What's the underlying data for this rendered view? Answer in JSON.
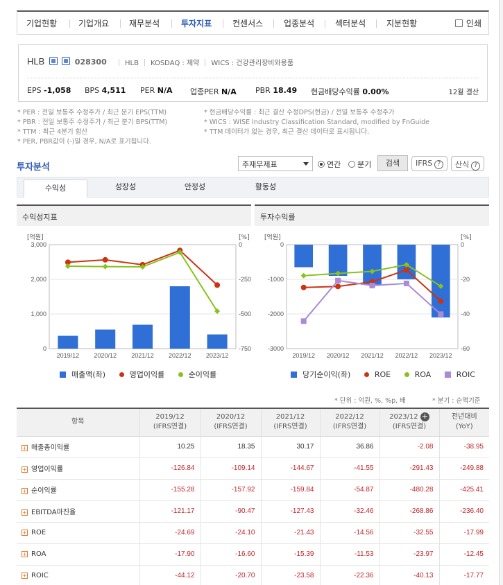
{
  "nav": {
    "tabs": [
      "기업현황",
      "기업개요",
      "재무분석",
      "투자지표",
      "컨센서스",
      "업종분석",
      "섹터분석",
      "지분현황"
    ],
    "active_index": 3,
    "print_label": "인쇄"
  },
  "corp": {
    "name": "HLB",
    "code": "028300",
    "ticker": "HLB",
    "market": "KOSDAQ : 제약",
    "wics": "WICS : 건강관리장비와용품",
    "indicators": [
      {
        "label": "EPS",
        "value": "-1,058"
      },
      {
        "label": "BPS",
        "value": "4,511"
      },
      {
        "label": "PER",
        "value": "N/A"
      },
      {
        "label": "업종PER",
        "value": "N/A"
      },
      {
        "label": "PBR",
        "value": "18.49"
      },
      {
        "label": "현금배당수익률",
        "value": "0.00%"
      }
    ],
    "settle": "12월 결산"
  },
  "notes": {
    "left": [
      "* PER : 전일 보통주 수정주가 / 최근 분기 EPS(TTM)",
      "* PBR : 전일 보통주 수정주가 / 최근 분기 BPS(TTM)",
      "* TTM : 최근 4분기 합산",
      "* PER, PBR값이 (-)일 경우, N/A로 표기됩니다."
    ],
    "right": [
      "* 현금배당수익률 : 최근 결산 수정DPS(현금) / 전일 보통주 수정주가",
      "* WICS : WISE Industry Classification Standard, modified by FnGuide",
      "* TTM 데이터가 없는 경우, 최근 결산 데이터로 표시됩니다."
    ]
  },
  "analysis": {
    "title": "투자분석",
    "select_value": "주재무제표",
    "radio_annual": "연간",
    "radio_quarter": "분기",
    "search_label": "검색",
    "ifrs_label": "IFRS",
    "formula_label": "산식",
    "subtabs": [
      "수익성",
      "성장성",
      "안정성",
      "활동성"
    ]
  },
  "charts": {
    "left_title": "수익성지표",
    "right_title": "투자수익률",
    "unit_left": "[억원]",
    "unit_right": "[%]"
  },
  "chart_data": [
    {
      "type": "bar",
      "title": "수익성지표",
      "categories": [
        "2019/12",
        "2020/12",
        "2021/12",
        "2022/12",
        "2023/12"
      ],
      "ylabel": "[억원]",
      "y2label": "[%]",
      "ylim": [
        0,
        3000
      ],
      "y2lim": [
        -750,
        0
      ],
      "yticks": [
        "3,000",
        "2,000",
        "1,000",
        "0"
      ],
      "y2ticks": [
        "0",
        "-250",
        "-500",
        "-750"
      ],
      "series": [
        {
          "name": "매출액(좌)",
          "type": "bar",
          "color": "#2f6fd6",
          "values": [
            370,
            550,
            690,
            1800,
            410
          ]
        },
        {
          "name": "영업이익률",
          "type": "line",
          "axis": "right",
          "color": "#cc3311",
          "values": [
            -126.84,
            -109.14,
            -144.67,
            -41.55,
            -291.43
          ]
        },
        {
          "name": "순이익률",
          "type": "line",
          "axis": "right",
          "color": "#88c21d",
          "values": [
            -155.28,
            -157.92,
            -159.84,
            -54.87,
            -480.28
          ]
        }
      ],
      "legend": "bottom"
    },
    {
      "type": "bar",
      "title": "투자수익률",
      "categories": [
        "2019/12",
        "2020/12",
        "2021/12",
        "2022/12",
        "2023/12"
      ],
      "ylabel": "[억원]",
      "y2label": "[%]",
      "ylim": [
        -3000,
        0
      ],
      "y2lim": [
        -60,
        0
      ],
      "yticks": [
        "0",
        "-1000",
        "-2000",
        "-3000"
      ],
      "y2ticks": [
        "0",
        "-20",
        "-40",
        "-60"
      ],
      "series": [
        {
          "name": "당기순이익(좌)",
          "type": "bar",
          "color": "#2f6fd6",
          "values": [
            -650,
            -900,
            -1150,
            -1000,
            -2100
          ]
        },
        {
          "name": "ROE",
          "type": "line",
          "axis": "right",
          "color": "#cc3311",
          "values": [
            -24.69,
            -24.1,
            -21.43,
            -14.56,
            -32.55
          ]
        },
        {
          "name": "ROA",
          "type": "line",
          "axis": "right",
          "color": "#88c21d",
          "values": [
            -17.9,
            -16.6,
            -15.39,
            -11.53,
            -23.97
          ]
        },
        {
          "name": "ROIC",
          "type": "line",
          "axis": "right",
          "color": "#a98bd8",
          "values": [
            -44.12,
            -20.7,
            -23.58,
            -22.36,
            -40.13
          ]
        }
      ],
      "legend": "bottom"
    }
  ],
  "table_meta": {
    "unit_note": "* 단위 : 억원, %, %p, 배",
    "quarter_note": "* 분기 : 순액기준"
  },
  "table": {
    "headers": [
      {
        "l1": "항목",
        "l2": ""
      },
      {
        "l1": "2019/12",
        "l2": "(IFRS연결)"
      },
      {
        "l1": "2020/12",
        "l2": "(IFRS연결)"
      },
      {
        "l1": "2021/12",
        "l2": "(IFRS연결)"
      },
      {
        "l1": "2022/12",
        "l2": "(IFRS연결)"
      },
      {
        "l1": "2023/12",
        "l2": "(IFRS연결)"
      },
      {
        "l1": "전년대비",
        "l2": "(YoY)"
      }
    ],
    "rows": [
      {
        "item": "매출총이익률",
        "values": [
          "10.25",
          "18.35",
          "30.17",
          "36.86",
          "-2.08",
          "-38.95"
        ]
      },
      {
        "item": "영업이익률",
        "values": [
          "-126.84",
          "-109.14",
          "-144.67",
          "-41.55",
          "-291.43",
          "-249.88"
        ]
      },
      {
        "item": "순이익률",
        "values": [
          "-155.28",
          "-157.92",
          "-159.84",
          "-54.87",
          "-480.28",
          "-425.41"
        ]
      },
      {
        "item": "EBITDA마진율",
        "values": [
          "-121.17",
          "-90.47",
          "-127.43",
          "-32.46",
          "-268.86",
          "-236.40"
        ]
      },
      {
        "item": "ROE",
        "values": [
          "-24.69",
          "-24.10",
          "-21.43",
          "-14.56",
          "-32.55",
          "-17.99"
        ]
      },
      {
        "item": "ROA",
        "values": [
          "-17.90",
          "-16.60",
          "-15.39",
          "-11.53",
          "-23.97",
          "-12.45"
        ]
      },
      {
        "item": "ROIC",
        "values": [
          "-44.12",
          "-20.70",
          "-23.58",
          "-22.36",
          "-40.13",
          "-17.77"
        ]
      }
    ]
  }
}
